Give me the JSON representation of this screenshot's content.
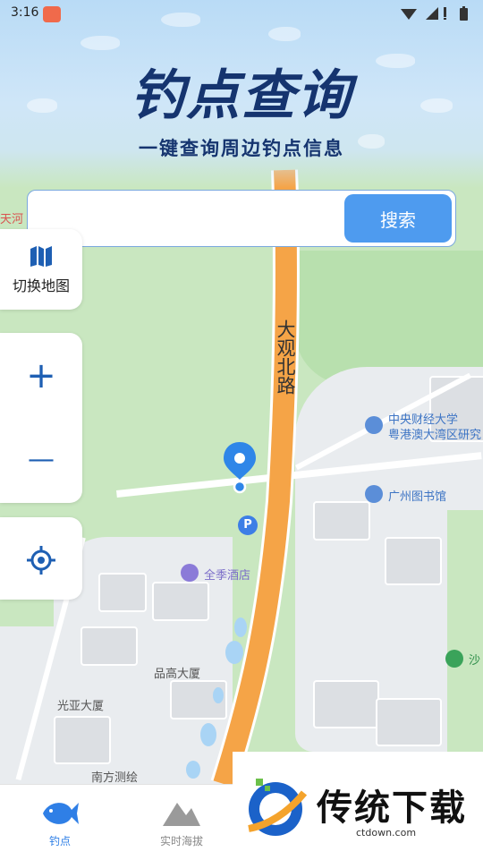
{
  "status_bar": {
    "time": "3:16"
  },
  "header": {
    "title": "钓点查询",
    "subtitle": "一键查询周边钓点信息"
  },
  "search": {
    "placeholder": "",
    "button_label": "搜索"
  },
  "controls": {
    "switch_map_label": "切换地图",
    "zoom_in": "+",
    "zoom_out": "—"
  },
  "map_labels": {
    "road": "大观北路",
    "tianhe": "天河",
    "univ_1": "中央财经大学",
    "univ_2": "粤港澳大湾区研究",
    "library": "广州图书馆",
    "hotel": "全季酒店",
    "building_1": "品高大厦",
    "building_2": "光亚大厦",
    "building_3": "南方测绘",
    "right_edge": "沙"
  },
  "bottom_nav": {
    "tabs": [
      {
        "label": "钓点",
        "active": true
      },
      {
        "label": "实时海拔",
        "active": false
      }
    ]
  },
  "watermark": {
    "brand": "传统下载",
    "url": "ctdown.com"
  },
  "colors": {
    "accent": "#4e9bef",
    "title": "#15346f",
    "road": "#f5a447"
  }
}
